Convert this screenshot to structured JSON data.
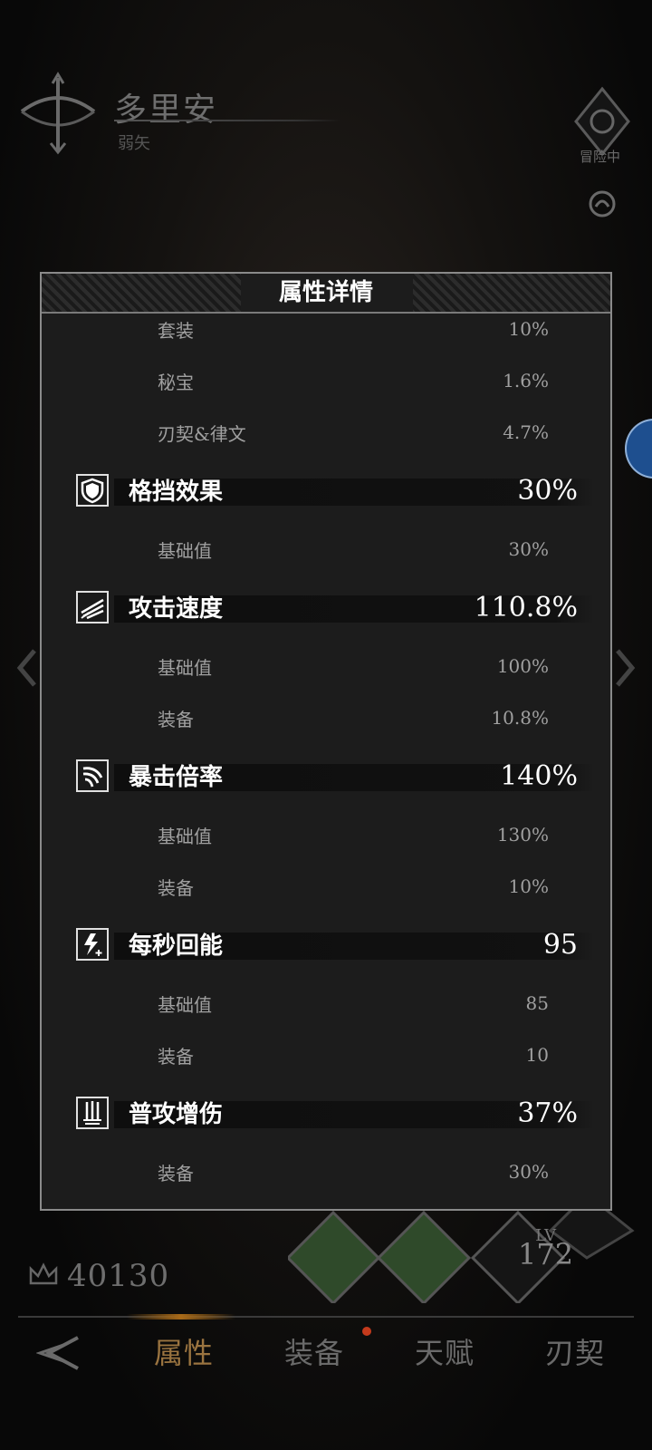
{
  "header": {
    "character_name": "多里安",
    "character_class": "弱矢",
    "status_label": "冒险中"
  },
  "modal": {
    "title": "属性详情",
    "rows": [
      {
        "kind": "sub",
        "label": "套装",
        "value": "10%"
      },
      {
        "kind": "sub",
        "label": "秘宝",
        "value": "1.6%"
      },
      {
        "kind": "sub",
        "label": "刃契&律文",
        "value": "4.7%"
      },
      {
        "kind": "stat",
        "icon": "shield-icon",
        "label": "格挡效果",
        "value": "30%"
      },
      {
        "kind": "sub",
        "label": "基础值",
        "value": "30%"
      },
      {
        "kind": "stat",
        "icon": "speed-wing-icon",
        "label": "攻击速度",
        "value": "110.8%"
      },
      {
        "kind": "sub",
        "label": "基础值",
        "value": "100%"
      },
      {
        "kind": "sub",
        "label": "装备",
        "value": "10.8%"
      },
      {
        "kind": "stat",
        "icon": "claw-icon",
        "label": "暴击倍率",
        "value": "140%"
      },
      {
        "kind": "sub",
        "label": "基础值",
        "value": "130%"
      },
      {
        "kind": "sub",
        "label": "装备",
        "value": "10%"
      },
      {
        "kind": "stat",
        "icon": "lightning-plus-icon",
        "label": "每秒回能",
        "value": "95"
      },
      {
        "kind": "sub",
        "label": "基础值",
        "value": "85"
      },
      {
        "kind": "sub",
        "label": "装备",
        "value": "10"
      },
      {
        "kind": "stat",
        "icon": "triple-blade-icon",
        "label": "普攻增伤",
        "value": "37%"
      },
      {
        "kind": "sub",
        "label": "装备",
        "value": "30%"
      }
    ]
  },
  "bottom": {
    "power_value": "40130",
    "level_label": "LV",
    "level_value": "172",
    "nav_tabs": [
      {
        "label": "属性",
        "active": true
      },
      {
        "label": "装备",
        "active": false,
        "badge": true
      },
      {
        "label": "天赋",
        "active": false
      },
      {
        "label": "刃契",
        "active": false
      }
    ]
  },
  "colors": {
    "modal_bg": "#1c1c1c",
    "accent_active_tab": "#9a7440",
    "badge_red": "#c43a1c"
  }
}
